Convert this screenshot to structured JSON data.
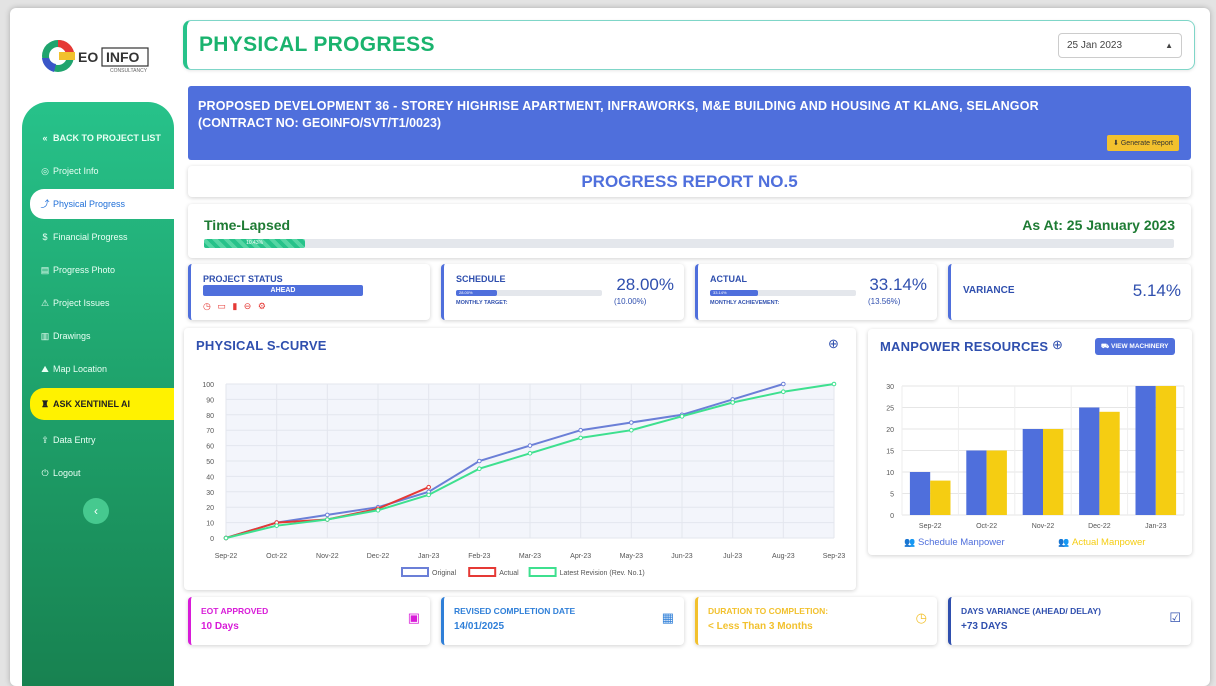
{
  "brand": {
    "logo_g": "G",
    "logo_text1": "EO",
    "logo_text2": "INFO",
    "logo_sub": "CONSULTANCY"
  },
  "header": {
    "title": "PHYSICAL PROGRESS",
    "date": "25 Jan 2023"
  },
  "sidebar": {
    "items": [
      {
        "label": "BACK TO PROJECT LIST",
        "icon": "«"
      },
      {
        "label": "Project Info",
        "icon": "◎"
      },
      {
        "label": "Physical Progress",
        "icon": "⤴"
      },
      {
        "label": "Financial Progress",
        "icon": "$"
      },
      {
        "label": "Progress Photo",
        "icon": "▤"
      },
      {
        "label": "Project Issues",
        "icon": "⚠"
      },
      {
        "label": "Drawings",
        "icon": "▥"
      },
      {
        "label": "Map Location",
        "icon": "⛰"
      },
      {
        "label": "ASK XENTINEL AI",
        "icon": "♜"
      },
      {
        "label": "Data Entry",
        "icon": "⇪"
      },
      {
        "label": "Logout",
        "icon": "⏻"
      }
    ],
    "collapse": "‹"
  },
  "project": {
    "line1": "PROPOSED DEVELOPMENT 36 - STOREY HIGHRISE APARTMENT, INFRAWORKS, M&E BUILDING AND HOUSING AT KLANG, SELANGOR",
    "line2": "(CONTRACT NO: GEOINFO/SVT/T1/0023)",
    "generate": "⬇ Generate Report"
  },
  "report": {
    "title": "PROGRESS REPORT NO.5"
  },
  "time_lapsed": {
    "label": "Time-Lapsed",
    "as_at": "As At: 25 January 2023",
    "pct_text": "10.43%",
    "pct": 10.43
  },
  "status": {
    "label": "PROJECT STATUS",
    "value": "AHEAD",
    "icons": "◷ ▭ ▮ ⊖ ⚙"
  },
  "schedule": {
    "label": "SCHEDULE",
    "value": "28.00%",
    "bar_text": "28.00%",
    "sub": "MONTHLY TARGET:",
    "sub_val": "(10.00%)",
    "pct": 28
  },
  "actual": {
    "label": "ACTUAL",
    "value": "33.14%",
    "bar_text": "33.14%",
    "sub": "MONTHLY ACHIEVEMENT:",
    "sub_val": "(13.56%)",
    "pct": 33.14
  },
  "variance": {
    "label": "VARIANCE",
    "value": "5.14%"
  },
  "scurve": {
    "title": "PHYSICAL S-CURVE"
  },
  "manpower": {
    "title": "MANPOWER RESOURCES",
    "view": "⛟ VIEW MACHINERY"
  },
  "chart_data": [
    {
      "type": "line",
      "title": "PHYSICAL S-CURVE",
      "x": [
        "Sep-22",
        "Oct-22",
        "Nov-22",
        "Dec-22",
        "Jan-23",
        "Feb-23",
        "Mar-23",
        "Apr-23",
        "May-23",
        "Jun-23",
        "Jul-23",
        "Aug-23",
        "Sep-23"
      ],
      "ylim": [
        0,
        100
      ],
      "yticks": [
        0,
        10,
        20,
        30,
        40,
        50,
        60,
        70,
        80,
        90,
        100
      ],
      "series": [
        {
          "name": "Original",
          "color": "#6b7fd7",
          "values": [
            0,
            10,
            15,
            20,
            30,
            50,
            60,
            70,
            75,
            80,
            90,
            100,
            null
          ]
        },
        {
          "name": "Actual",
          "color": "#e53935",
          "values": [
            0,
            10,
            12,
            19,
            33,
            null,
            null,
            null,
            null,
            null,
            null,
            null,
            null
          ]
        },
        {
          "name": "Latest Revision (Rev. No.1)",
          "color": "#3ee08f",
          "values": [
            0,
            8,
            12,
            18,
            28,
            45,
            55,
            65,
            70,
            79,
            88,
            95,
            100
          ]
        }
      ],
      "legend": "bottom",
      "grid": true
    },
    {
      "type": "bar",
      "categories": [
        "Sep-22",
        "Oct-22",
        "Nov-22",
        "Dec-22",
        "Jan-23"
      ],
      "ylim": [
        0,
        30
      ],
      "yticks": [
        0,
        5,
        10,
        15,
        20,
        25,
        30
      ],
      "series": [
        {
          "name": "Schedule Manpower",
          "color": "#4f6fdc",
          "values": [
            10,
            15,
            20,
            25,
            30
          ]
        },
        {
          "name": "Actual Manpower",
          "color": "#f5cd12",
          "values": [
            8,
            15,
            20,
            24,
            30
          ]
        }
      ],
      "legend": "bottom",
      "grid": true
    }
  ],
  "bottom": [
    {
      "label": "EOT APPROVED",
      "value": "10 Days",
      "color": "#d81bd8",
      "icon": "▣"
    },
    {
      "label": "REVISED COMPLETION DATE",
      "value": "14/01/2025",
      "color": "#2f7fd8",
      "icon": "▦"
    },
    {
      "label": "DURATION TO COMPLETION:",
      "value": "< Less Than 3 Months",
      "color": "#f2c12e",
      "icon": "◷"
    },
    {
      "label": "DAYS VARIANCE (AHEAD/ DELAY)",
      "value": "+73 DAYS",
      "color": "#2f4fae",
      "icon": "☑"
    }
  ]
}
